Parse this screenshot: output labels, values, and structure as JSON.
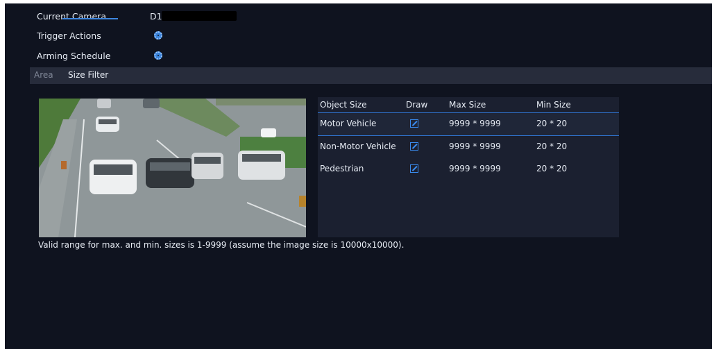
{
  "settings": {
    "current_camera_label": "Current Camera",
    "current_camera_value": "D1",
    "trigger_actions_label": "Trigger Actions",
    "arming_schedule_label": "Arming Schedule"
  },
  "tabs": [
    {
      "label": "Area",
      "active": false
    },
    {
      "label": "Size Filter",
      "active": true
    }
  ],
  "table": {
    "headers": [
      "Object Size",
      "Draw",
      "Max Size",
      "Min Size"
    ],
    "rows": [
      {
        "object": "Motor Vehicle",
        "max": "9999 * 9999",
        "min": "20 * 20"
      },
      {
        "object": "Non-Motor Vehicle",
        "max": "9999 * 9999",
        "min": "20 * 20"
      },
      {
        "object": "Pedestrian",
        "max": "9999 * 9999",
        "min": "20 * 20"
      }
    ]
  },
  "note": "Valid range for max. and min. sizes is 1-9999 (assume the image size is 10000x10000).",
  "colors": {
    "panel": "#0f131f",
    "accent": "#3a8cf0",
    "tabbar": "#272c3b"
  },
  "icons": {
    "trigger": "gear-icon",
    "schedule": "gear-icon",
    "draw": "edit-icon"
  }
}
